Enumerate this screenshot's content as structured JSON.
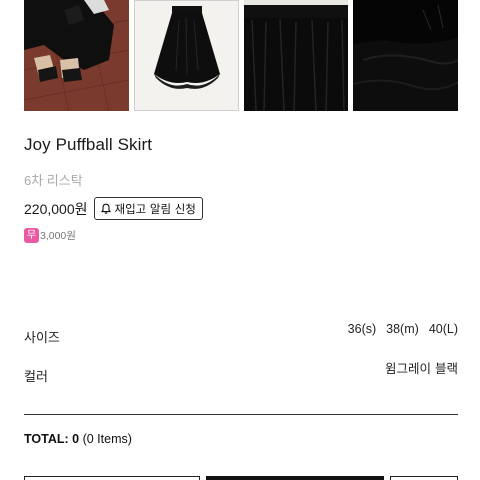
{
  "product": {
    "name": "Joy Puffball Skirt",
    "subtitle": "6차 리스탁",
    "price": "220,000원",
    "restock_label": "재입고 알림 신청",
    "shipping_badge": "무",
    "shipping_fee": "3,000원"
  },
  "thumbnails": [
    {
      "name": "model-photo",
      "bg": "#7a3b2e"
    },
    {
      "name": "skirt-flat-photo",
      "bg": "#f4f2ee"
    },
    {
      "name": "waistband-detail-photo",
      "bg": "#e9e7e3"
    },
    {
      "name": "fabric-detail-photo",
      "bg": "#0d0d0d"
    }
  ],
  "options": {
    "size_label": "사이즈",
    "sizes": [
      "36(s)",
      "38(m)",
      "40(L)"
    ],
    "color_label": "컬러",
    "color_value": "윔그레이 블랙"
  },
  "total": {
    "label": "TOTAL: 0",
    "items": "(0 Items)"
  },
  "colors": {
    "shipping_badge": "#e75ba3",
    "text": "#1a1a1a",
    "muted": "#a9a9a9"
  }
}
